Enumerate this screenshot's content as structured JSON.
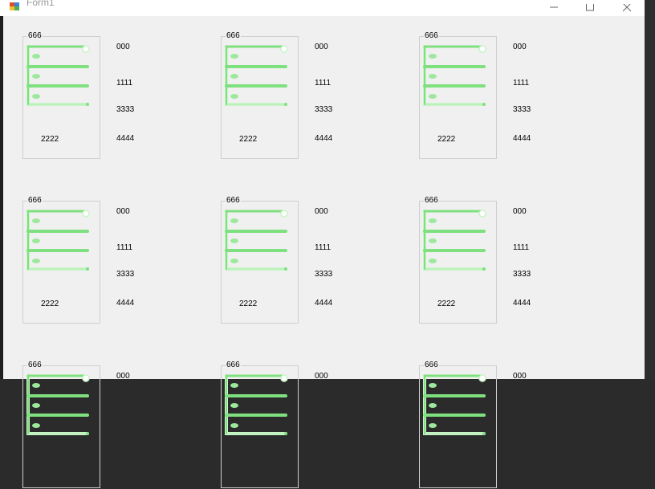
{
  "window": {
    "title": "Form1"
  },
  "cards": [
    {
      "caption": "666",
      "a": "000",
      "b": "1111",
      "c": "3333",
      "d": "4444",
      "e": "2222"
    },
    {
      "caption": "666",
      "a": "000",
      "b": "1111",
      "c": "3333",
      "d": "4444",
      "e": "2222"
    },
    {
      "caption": "666",
      "a": "000",
      "b": "1111",
      "c": "3333",
      "d": "4444",
      "e": "2222"
    },
    {
      "caption": "666",
      "a": "000",
      "b": "1111",
      "c": "3333",
      "d": "4444",
      "e": "2222"
    },
    {
      "caption": "666",
      "a": "000",
      "b": "1111",
      "c": "3333",
      "d": "4444",
      "e": "2222"
    },
    {
      "caption": "666",
      "a": "000",
      "b": "1111",
      "c": "3333",
      "d": "4444",
      "e": "2222"
    },
    {
      "caption": "666",
      "a": "000"
    },
    {
      "caption": "666",
      "a": "000"
    },
    {
      "caption": "666",
      "a": "000"
    }
  ],
  "colors": {
    "graphic_green": "#7fe07f",
    "graphic_light": "#c8f5c8"
  }
}
